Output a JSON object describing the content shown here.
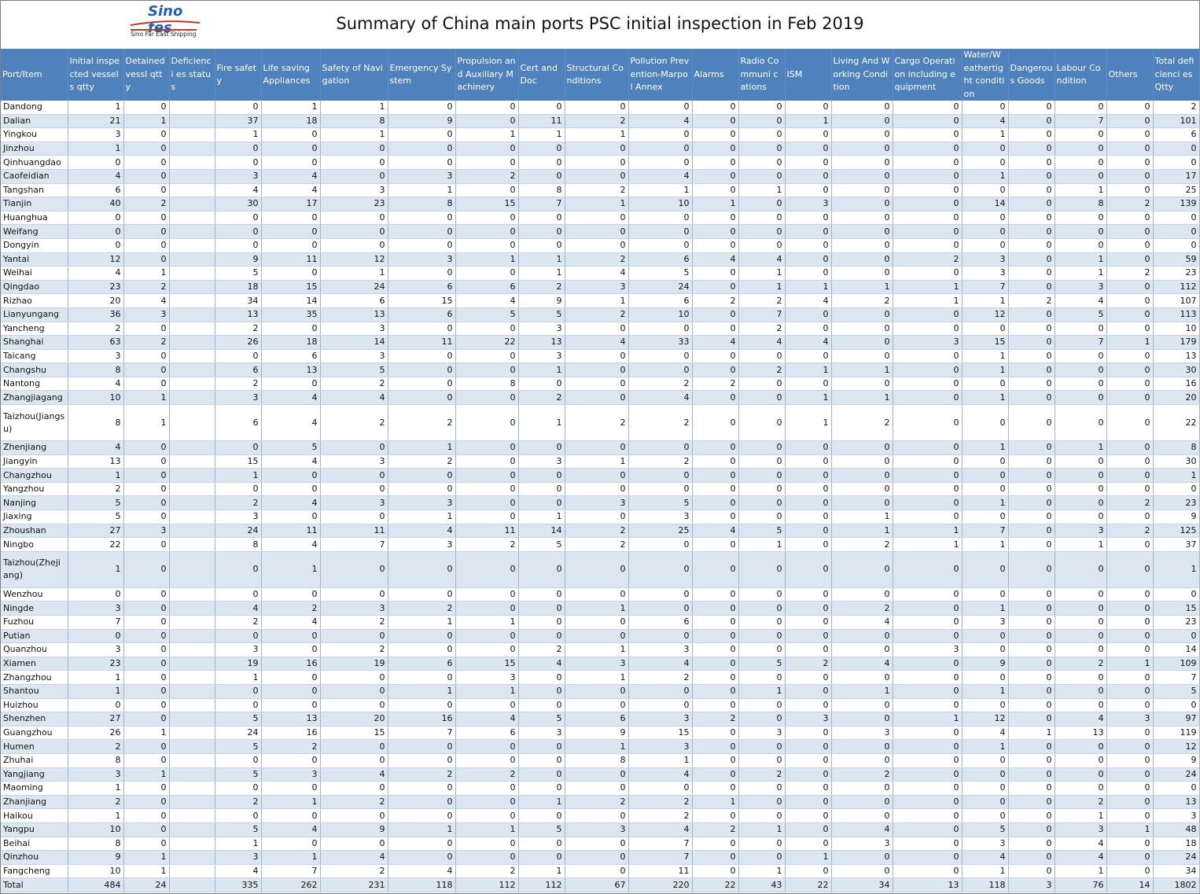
{
  "logo": {
    "main": "Sino fes",
    "sub": "Sino Far East Shipping"
  },
  "title": "Summary of China main ports PSC initial inspection in Feb 2019",
  "headers": [
    "Port/Item",
    "Initial inspected vessels qtty",
    "Detained vessl qtty",
    "Deficienci es status",
    "Fire safety",
    "Life saving Appliances",
    "Safety of Navigation",
    "Emergency System",
    "Propulsion and Auxiliary Machinery",
    "Cert and Doc",
    "Structural Conditions",
    "Pollution Prevention-Marpol Annex",
    "Alarms",
    "Radio Communi cations",
    "ISM",
    "Living And Working Condition",
    "Cargo Operation including equipment",
    "Water/W eathertig ht condition",
    "Dangerou s Goods",
    "Labour Condition",
    "Others",
    "Total deficienci es Qtty"
  ],
  "rows": [
    {
      "port": "Dandong",
      "v": [
        "1",
        "0",
        "",
        "0",
        "1",
        "1",
        "0",
        "0",
        "0",
        "0",
        "0",
        "0",
        "0",
        "0",
        "0",
        "0",
        "0",
        "0",
        "0",
        "0",
        "2"
      ]
    },
    {
      "port": "Dalian",
      "v": [
        "21",
        "1",
        "",
        "37",
        "18",
        "8",
        "9",
        "0",
        "11",
        "2",
        "4",
        "0",
        "0",
        "1",
        "0",
        "0",
        "4",
        "0",
        "7",
        "0",
        "101"
      ]
    },
    {
      "port": "Yingkou",
      "v": [
        "3",
        "0",
        "",
        "1",
        "0",
        "1",
        "0",
        "1",
        "1",
        "1",
        "0",
        "0",
        "0",
        "0",
        "0",
        "0",
        "1",
        "0",
        "0",
        "0",
        "6"
      ]
    },
    {
      "port": "Jinzhou",
      "v": [
        "1",
        "0",
        "",
        "0",
        "0",
        "0",
        "0",
        "0",
        "0",
        "0",
        "0",
        "0",
        "0",
        "0",
        "0",
        "0",
        "0",
        "0",
        "0",
        "0",
        "0"
      ]
    },
    {
      "port": "Qinhuangdao",
      "v": [
        "0",
        "0",
        "",
        "0",
        "0",
        "0",
        "0",
        "0",
        "0",
        "0",
        "0",
        "0",
        "0",
        "0",
        "0",
        "0",
        "0",
        "0",
        "0",
        "0",
        "0"
      ]
    },
    {
      "port": "Caofeidian",
      "v": [
        "4",
        "0",
        "",
        "3",
        "4",
        "0",
        "3",
        "2",
        "0",
        "0",
        "4",
        "0",
        "0",
        "0",
        "0",
        "0",
        "1",
        "0",
        "0",
        "0",
        "17"
      ]
    },
    {
      "port": "Tangshan",
      "v": [
        "6",
        "0",
        "",
        "4",
        "4",
        "3",
        "1",
        "0",
        "8",
        "2",
        "1",
        "0",
        "1",
        "0",
        "0",
        "0",
        "0",
        "0",
        "1",
        "0",
        "25"
      ]
    },
    {
      "port": "Tianjin",
      "v": [
        "40",
        "2",
        "",
        "30",
        "17",
        "23",
        "8",
        "15",
        "7",
        "1",
        "10",
        "1",
        "0",
        "3",
        "0",
        "0",
        "14",
        "0",
        "8",
        "2",
        "139"
      ]
    },
    {
      "port": "Huanghua",
      "v": [
        "0",
        "0",
        "",
        "0",
        "0",
        "0",
        "0",
        "0",
        "0",
        "0",
        "0",
        "0",
        "0",
        "0",
        "0",
        "0",
        "0",
        "0",
        "0",
        "0",
        "0"
      ]
    },
    {
      "port": "Weifang",
      "v": [
        "0",
        "0",
        "",
        "0",
        "0",
        "0",
        "0",
        "0",
        "0",
        "0",
        "0",
        "0",
        "0",
        "0",
        "0",
        "0",
        "0",
        "0",
        "0",
        "0",
        "0"
      ]
    },
    {
      "port": "Dongyin",
      "v": [
        "0",
        "0",
        "",
        "0",
        "0",
        "0",
        "0",
        "0",
        "0",
        "0",
        "0",
        "0",
        "0",
        "0",
        "0",
        "0",
        "0",
        "0",
        "0",
        "0",
        "0"
      ]
    },
    {
      "port": "Yantai",
      "v": [
        "12",
        "0",
        "",
        "9",
        "11",
        "12",
        "3",
        "1",
        "1",
        "2",
        "6",
        "4",
        "4",
        "0",
        "0",
        "2",
        "3",
        "0",
        "1",
        "0",
        "59"
      ]
    },
    {
      "port": "Weihai",
      "v": [
        "4",
        "1",
        "",
        "5",
        "0",
        "1",
        "0",
        "0",
        "1",
        "4",
        "5",
        "0",
        "1",
        "0",
        "0",
        "0",
        "3",
        "0",
        "1",
        "2",
        "23"
      ]
    },
    {
      "port": "Qingdao",
      "v": [
        "23",
        "2",
        "",
        "18",
        "15",
        "24",
        "6",
        "6",
        "2",
        "3",
        "24",
        "0",
        "1",
        "1",
        "1",
        "1",
        "7",
        "0",
        "3",
        "0",
        "112"
      ]
    },
    {
      "port": "Rizhao",
      "v": [
        "20",
        "4",
        "",
        "34",
        "14",
        "6",
        "15",
        "4",
        "9",
        "1",
        "6",
        "2",
        "2",
        "4",
        "2",
        "1",
        "1",
        "2",
        "4",
        "0",
        "107"
      ]
    },
    {
      "port": "Lianyungang",
      "v": [
        "36",
        "3",
        "",
        "13",
        "35",
        "13",
        "6",
        "5",
        "5",
        "2",
        "10",
        "0",
        "7",
        "0",
        "0",
        "0",
        "12",
        "0",
        "5",
        "0",
        "113"
      ]
    },
    {
      "port": "Yancheng",
      "v": [
        "2",
        "0",
        "",
        "2",
        "0",
        "3",
        "0",
        "0",
        "3",
        "0",
        "0",
        "0",
        "2",
        "0",
        "0",
        "0",
        "0",
        "0",
        "0",
        "0",
        "10"
      ]
    },
    {
      "port": "Shanghai",
      "v": [
        "63",
        "2",
        "",
        "26",
        "18",
        "14",
        "11",
        "22",
        "13",
        "4",
        "33",
        "4",
        "4",
        "4",
        "0",
        "3",
        "15",
        "0",
        "7",
        "1",
        "179"
      ]
    },
    {
      "port": "Taicang",
      "v": [
        "3",
        "0",
        "",
        "0",
        "6",
        "3",
        "0",
        "0",
        "3",
        "0",
        "0",
        "0",
        "0",
        "0",
        "0",
        "0",
        "1",
        "0",
        "0",
        "0",
        "13"
      ]
    },
    {
      "port": "Changshu",
      "v": [
        "8",
        "0",
        "",
        "6",
        "13",
        "5",
        "0",
        "0",
        "1",
        "0",
        "0",
        "0",
        "2",
        "1",
        "1",
        "0",
        "1",
        "0",
        "0",
        "0",
        "30"
      ]
    },
    {
      "port": "Nantong",
      "v": [
        "4",
        "0",
        "",
        "2",
        "0",
        "2",
        "0",
        "8",
        "0",
        "0",
        "2",
        "2",
        "0",
        "0",
        "0",
        "0",
        "0",
        "0",
        "0",
        "0",
        "16"
      ]
    },
    {
      "port": "Zhangjiagang",
      "v": [
        "10",
        "1",
        "",
        "3",
        "4",
        "4",
        "0",
        "0",
        "2",
        "0",
        "4",
        "0",
        "0",
        "1",
        "1",
        "0",
        "1",
        "0",
        "0",
        "0",
        "20"
      ]
    },
    {
      "port": "Taizhou(Jiangsu)",
      "v": [
        "8",
        "1",
        "",
        "6",
        "4",
        "2",
        "2",
        "0",
        "1",
        "2",
        "2",
        "0",
        "0",
        "1",
        "2",
        "0",
        "0",
        "0",
        "0",
        "0",
        "22"
      ],
      "tall": true
    },
    {
      "port": "Zhenjiang",
      "v": [
        "4",
        "0",
        "",
        "0",
        "5",
        "0",
        "1",
        "0",
        "0",
        "0",
        "0",
        "0",
        "0",
        "0",
        "0",
        "0",
        "1",
        "0",
        "1",
        "0",
        "8"
      ]
    },
    {
      "port": "Jiangyin",
      "v": [
        "13",
        "0",
        "",
        "15",
        "4",
        "3",
        "2",
        "0",
        "3",
        "1",
        "2",
        "0",
        "0",
        "0",
        "0",
        "0",
        "0",
        "0",
        "0",
        "0",
        "30"
      ]
    },
    {
      "port": "Changzhou",
      "v": [
        "1",
        "0",
        "",
        "1",
        "0",
        "0",
        "0",
        "0",
        "0",
        "0",
        "0",
        "0",
        "0",
        "0",
        "0",
        "0",
        "0",
        "0",
        "0",
        "0",
        "1"
      ]
    },
    {
      "port": "Yangzhou",
      "v": [
        "2",
        "0",
        "",
        "0",
        "0",
        "0",
        "0",
        "0",
        "0",
        "0",
        "0",
        "0",
        "0",
        "0",
        "0",
        "0",
        "0",
        "0",
        "0",
        "0",
        "0"
      ]
    },
    {
      "port": "Nanjing",
      "v": [
        "5",
        "0",
        "",
        "2",
        "4",
        "3",
        "3",
        "0",
        "0",
        "3",
        "5",
        "0",
        "0",
        "0",
        "0",
        "0",
        "1",
        "0",
        "0",
        "2",
        "23"
      ]
    },
    {
      "port": "Jiaxing",
      "v": [
        "5",
        "0",
        "",
        "3",
        "0",
        "0",
        "1",
        "0",
        "1",
        "0",
        "3",
        "0",
        "0",
        "0",
        "1",
        "0",
        "0",
        "0",
        "0",
        "0",
        "9"
      ]
    },
    {
      "port": "Zhoushan",
      "v": [
        "27",
        "3",
        "",
        "24",
        "11",
        "11",
        "4",
        "11",
        "14",
        "2",
        "25",
        "4",
        "5",
        "0",
        "1",
        "1",
        "7",
        "0",
        "3",
        "2",
        "125"
      ]
    },
    {
      "port": "Ningbo",
      "v": [
        "22",
        "0",
        "",
        "8",
        "4",
        "7",
        "3",
        "2",
        "5",
        "2",
        "0",
        "0",
        "1",
        "0",
        "2",
        "1",
        "1",
        "0",
        "1",
        "0",
        "37"
      ]
    },
    {
      "port": "Taizhou(Zhejiang)",
      "v": [
        "1",
        "0",
        "",
        "0",
        "1",
        "0",
        "0",
        "0",
        "0",
        "0",
        "0",
        "0",
        "0",
        "0",
        "0",
        "0",
        "0",
        "0",
        "0",
        "0",
        "1"
      ],
      "tall": true
    },
    {
      "port": "Wenzhou",
      "v": [
        "0",
        "0",
        "",
        "0",
        "0",
        "0",
        "0",
        "0",
        "0",
        "0",
        "0",
        "0",
        "0",
        "0",
        "0",
        "0",
        "0",
        "0",
        "0",
        "0",
        "0"
      ]
    },
    {
      "port": "Ningde",
      "v": [
        "3",
        "0",
        "",
        "4",
        "2",
        "3",
        "2",
        "0",
        "0",
        "1",
        "0",
        "0",
        "0",
        "0",
        "2",
        "0",
        "1",
        "0",
        "0",
        "0",
        "15"
      ]
    },
    {
      "port": "Fuzhou",
      "v": [
        "7",
        "0",
        "",
        "2",
        "4",
        "2",
        "1",
        "1",
        "0",
        "0",
        "6",
        "0",
        "0",
        "0",
        "4",
        "0",
        "3",
        "0",
        "0",
        "0",
        "23"
      ]
    },
    {
      "port": "Putian",
      "v": [
        "0",
        "0",
        "",
        "0",
        "0",
        "0",
        "0",
        "0",
        "0",
        "0",
        "0",
        "0",
        "0",
        "0",
        "0",
        "0",
        "0",
        "0",
        "0",
        "0",
        "0"
      ]
    },
    {
      "port": "Quanzhou",
      "v": [
        "3",
        "0",
        "",
        "3",
        "0",
        "2",
        "0",
        "0",
        "2",
        "1",
        "3",
        "0",
        "0",
        "0",
        "0",
        "3",
        "0",
        "0",
        "0",
        "0",
        "14"
      ]
    },
    {
      "port": "Xiamen",
      "v": [
        "23",
        "0",
        "",
        "19",
        "16",
        "19",
        "6",
        "15",
        "4",
        "3",
        "4",
        "0",
        "5",
        "2",
        "4",
        "0",
        "9",
        "0",
        "2",
        "1",
        "109"
      ]
    },
    {
      "port": "Zhangzhou",
      "v": [
        "1",
        "0",
        "",
        "1",
        "0",
        "0",
        "0",
        "3",
        "0",
        "1",
        "2",
        "0",
        "0",
        "0",
        "0",
        "0",
        "0",
        "0",
        "0",
        "0",
        "7"
      ]
    },
    {
      "port": "Shantou",
      "v": [
        "1",
        "0",
        "",
        "0",
        "0",
        "0",
        "1",
        "1",
        "0",
        "0",
        "0",
        "0",
        "1",
        "0",
        "1",
        "0",
        "1",
        "0",
        "0",
        "0",
        "5"
      ]
    },
    {
      "port": "Huizhou",
      "v": [
        "0",
        "0",
        "",
        "0",
        "0",
        "0",
        "0",
        "0",
        "0",
        "0",
        "0",
        "0",
        "0",
        "0",
        "0",
        "0",
        "0",
        "0",
        "0",
        "0",
        "0"
      ]
    },
    {
      "port": "Shenzhen",
      "v": [
        "27",
        "0",
        "",
        "5",
        "13",
        "20",
        "16",
        "4",
        "5",
        "6",
        "3",
        "2",
        "0",
        "3",
        "0",
        "1",
        "12",
        "0",
        "4",
        "3",
        "97"
      ]
    },
    {
      "port": "Guangzhou",
      "v": [
        "26",
        "1",
        "",
        "24",
        "16",
        "15",
        "7",
        "6",
        "3",
        "9",
        "15",
        "0",
        "3",
        "0",
        "3",
        "0",
        "4",
        "1",
        "13",
        "0",
        "119"
      ]
    },
    {
      "port": "Humen",
      "v": [
        "2",
        "0",
        "",
        "5",
        "2",
        "0",
        "0",
        "0",
        "0",
        "1",
        "3",
        "0",
        "0",
        "0",
        "0",
        "0",
        "1",
        "0",
        "0",
        "0",
        "12"
      ]
    },
    {
      "port": "Zhuhai",
      "v": [
        "8",
        "0",
        "",
        "0",
        "0",
        "0",
        "0",
        "0",
        "0",
        "8",
        "1",
        "0",
        "0",
        "0",
        "0",
        "0",
        "0",
        "0",
        "0",
        "0",
        "9"
      ]
    },
    {
      "port": "Yangjiang",
      "v": [
        "3",
        "1",
        "",
        "5",
        "3",
        "4",
        "2",
        "2",
        "0",
        "0",
        "4",
        "0",
        "2",
        "0",
        "2",
        "0",
        "0",
        "0",
        "0",
        "0",
        "24"
      ]
    },
    {
      "port": "Maoming",
      "v": [
        "1",
        "0",
        "",
        "0",
        "0",
        "0",
        "0",
        "0",
        "0",
        "0",
        "0",
        "0",
        "0",
        "0",
        "0",
        "0",
        "0",
        "0",
        "0",
        "0",
        "0"
      ]
    },
    {
      "port": "Zhanjiang",
      "v": [
        "2",
        "0",
        "",
        "2",
        "1",
        "2",
        "0",
        "0",
        "1",
        "2",
        "2",
        "1",
        "0",
        "0",
        "0",
        "0",
        "0",
        "0",
        "2",
        "0",
        "13"
      ]
    },
    {
      "port": "Haikou",
      "v": [
        "1",
        "0",
        "",
        "0",
        "0",
        "0",
        "0",
        "0",
        "0",
        "0",
        "2",
        "0",
        "0",
        "0",
        "0",
        "0",
        "0",
        "0",
        "1",
        "0",
        "3"
      ]
    },
    {
      "port": "Yangpu",
      "v": [
        "10",
        "0",
        "",
        "5",
        "4",
        "9",
        "1",
        "1",
        "5",
        "3",
        "4",
        "2",
        "1",
        "0",
        "4",
        "0",
        "5",
        "0",
        "3",
        "1",
        "48"
      ]
    },
    {
      "port": "Beihai",
      "v": [
        "8",
        "0",
        "",
        "1",
        "0",
        "0",
        "0",
        "0",
        "0",
        "0",
        "7",
        "0",
        "0",
        "0",
        "3",
        "0",
        "3",
        "0",
        "4",
        "0",
        "18"
      ]
    },
    {
      "port": "Qinzhou",
      "v": [
        "9",
        "1",
        "",
        "3",
        "1",
        "4",
        "0",
        "0",
        "0",
        "0",
        "7",
        "0",
        "0",
        "1",
        "0",
        "0",
        "4",
        "0",
        "4",
        "0",
        "24"
      ]
    },
    {
      "port": "Fangcheng",
      "v": [
        "10",
        "1",
        "",
        "4",
        "7",
        "2",
        "4",
        "2",
        "1",
        "0",
        "11",
        "0",
        "1",
        "0",
        "0",
        "0",
        "1",
        "0",
        "1",
        "0",
        "34"
      ]
    },
    {
      "port": "Total",
      "v": [
        "484",
        "24",
        "",
        "335",
        "262",
        "231",
        "118",
        "112",
        "112",
        "67",
        "220",
        "22",
        "43",
        "22",
        "34",
        "13",
        "118",
        "3",
        "76",
        "14",
        "1802"
      ],
      "total": true
    }
  ]
}
